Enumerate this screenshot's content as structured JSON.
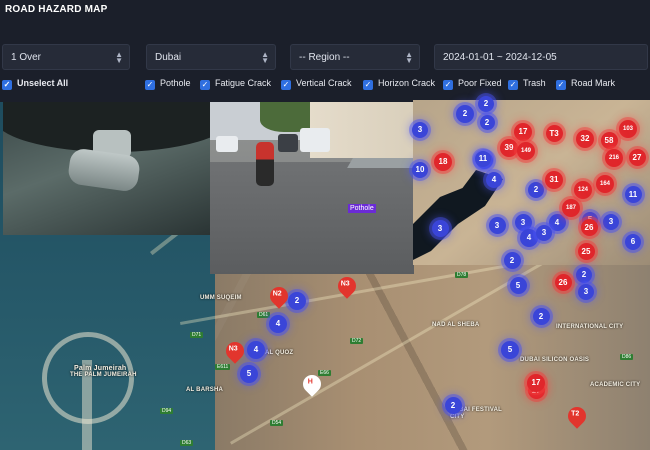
{
  "app": {
    "title": "ROAD HAZARD MAP"
  },
  "filters_bar": {
    "threshold": "1 Over",
    "city": "Dubai",
    "region": "-- Region --",
    "date_range": "2024-01-01 ~ 2024-12-05"
  },
  "hazard_filters": {
    "unselect_all": "Unselect All",
    "items": [
      {
        "label": "Pothole",
        "checked": true
      },
      {
        "label": "Fatigue Crack",
        "checked": true
      },
      {
        "label": "Vertical Crack",
        "checked": true
      },
      {
        "label": "Horizon Crack",
        "checked": true
      },
      {
        "label": "Poor Fixed",
        "checked": true
      },
      {
        "label": "Trash",
        "checked": true
      },
      {
        "label": "Road Mark",
        "checked": true
      }
    ]
  },
  "photos": {
    "road_tag": "Pothole"
  },
  "map": {
    "areas": [
      "UMM SUQEIM",
      "AL BARSHA",
      "Palm Jumeirah",
      "THE PALM JUMEIRAH",
      "NAD AL SHEBA",
      "DUBAI SILICON OASIS",
      "INTERNATIONAL CITY",
      "ACADEMIC CITY",
      "AL QUOZ",
      "DUBAI FESTIVAL CITY"
    ],
    "road_shields": [
      "D61",
      "D71",
      "E66",
      "E611",
      "D94",
      "D72",
      "D63",
      "D78",
      "D54",
      "D86"
    ],
    "blue_clusters": [
      "2",
      "2",
      "2",
      "3",
      "11",
      "4",
      "10",
      "3",
      "3",
      "3",
      "4",
      "4",
      "2",
      "5",
      "2",
      "3",
      "5",
      "3",
      "2",
      "3",
      "2",
      "5",
      "6",
      "11",
      "11",
      "2",
      "4",
      "4",
      "5",
      "2"
    ],
    "red_clusters": [
      "17",
      "T3",
      "32",
      "103",
      "58",
      "216",
      "27",
      "17",
      "39",
      "149",
      "18",
      "31",
      "124",
      "164",
      "187",
      "26",
      "26",
      "25",
      "17"
    ],
    "pins": [
      "N2",
      "N3",
      "N3",
      "H",
      "T2"
    ],
    "colors": {
      "header_bg": "#1b1f2a",
      "checkbox": "#2f6fe0",
      "blue_cluster": "#3a45d8",
      "red_cluster": "#e0262b",
      "road_tag": "#6b2bd6"
    }
  }
}
